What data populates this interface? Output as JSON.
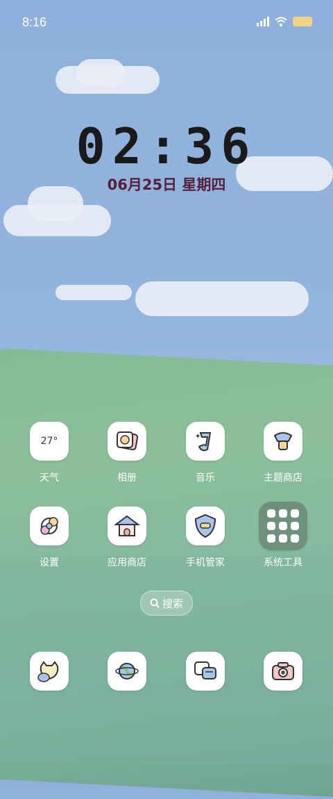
{
  "status_bar": {
    "time": "8:16",
    "battery_level": ""
  },
  "clock": {
    "time": "02:36",
    "date": "06月25日 星期四"
  },
  "apps_row1": [
    {
      "label": "天气",
      "tile_text": "27°",
      "icon": "weather-icon"
    },
    {
      "label": "相册",
      "icon": "album-icon"
    },
    {
      "label": "音乐",
      "icon": "music-icon"
    },
    {
      "label": "主题商店",
      "icon": "theme-store-icon"
    }
  ],
  "apps_row2": [
    {
      "label": "设置",
      "icon": "settings-icon"
    },
    {
      "label": "应用商店",
      "icon": "app-store-icon"
    },
    {
      "label": "手机管家",
      "icon": "phone-manager-icon"
    },
    {
      "label": "系统工具",
      "icon": "system-tools-folder-icon"
    }
  ],
  "search": {
    "label": "搜索"
  },
  "dock": [
    {
      "icon": "cat-chat-icon"
    },
    {
      "icon": "browser-globe-icon"
    },
    {
      "icon": "messages-icon"
    },
    {
      "icon": "camera-icon"
    }
  ]
}
